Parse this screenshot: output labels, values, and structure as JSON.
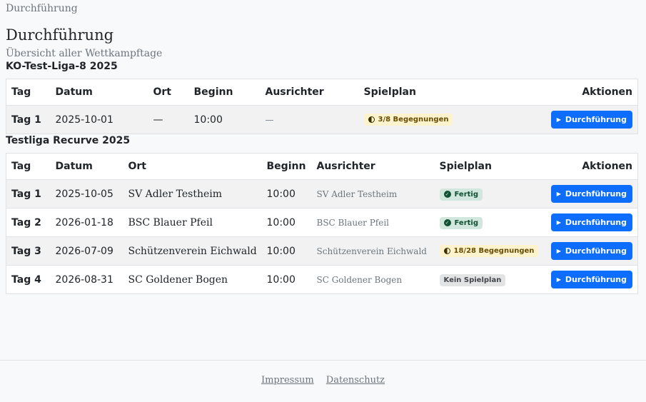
{
  "breadcrumb": "Durchführung",
  "page": {
    "title": "Durchführung",
    "subtitle": "Übersicht aller Wettkampftage"
  },
  "columns": {
    "tag": "Tag",
    "datum": "Datum",
    "ort": "Ort",
    "beginn": "Beginn",
    "ausrichter": "Ausrichter",
    "spielplan": "Spielplan",
    "aktionen": "Aktionen"
  },
  "leagues": [
    {
      "title": "KO-Test-Liga-8 2025",
      "rows": [
        {
          "tag": "Tag 1",
          "datum": "2025-10-01",
          "ort": "—",
          "beginn": "10:00",
          "ausrichter": "—",
          "spielplan": "3/8 Begegnungen",
          "status": "partial",
          "action": "Durchführung"
        }
      ]
    },
    {
      "title": "Testliga Recurve 2025",
      "rows": [
        {
          "tag": "Tag 1",
          "datum": "2025-10-05",
          "ort": "SV Adler Testheim",
          "beginn": "10:00",
          "ausrichter": "SV Adler Testheim",
          "spielplan": "Fertig",
          "status": "done",
          "action": "Durchführung"
        },
        {
          "tag": "Tag 2",
          "datum": "2026-01-18",
          "ort": "BSC Blauer Pfeil",
          "beginn": "10:00",
          "ausrichter": "BSC Blauer Pfeil",
          "spielplan": "Fertig",
          "status": "done",
          "action": "Durchführung"
        },
        {
          "tag": "Tag 3",
          "datum": "2026-07-09",
          "ort": "Schützenverein Eichwald",
          "beginn": "10:00",
          "ausrichter": "Schützenverein Eichwald",
          "spielplan": "18/28 Begegnungen",
          "status": "partial",
          "action": "Durchführung"
        },
        {
          "tag": "Tag 4",
          "datum": "2026-08-31",
          "ort": "SC Goldener Bogen",
          "beginn": "10:00",
          "ausrichter": "SC Goldener Bogen",
          "spielplan": "Kein Spielplan",
          "status": "none",
          "action": "Durchführung"
        }
      ]
    }
  ],
  "footer": {
    "impressum": "Impressum",
    "datenschutz": "Datenschutz"
  },
  "icons": {
    "partial": "half-circle-icon",
    "done": "check-circle-icon",
    "play": "play-icon"
  },
  "colors": {
    "primary": "#0d6efd",
    "badge_warn_bg": "#fff3cd",
    "badge_ok_bg": "#d1e7dd",
    "badge_none_bg": "#e2e3e5"
  }
}
